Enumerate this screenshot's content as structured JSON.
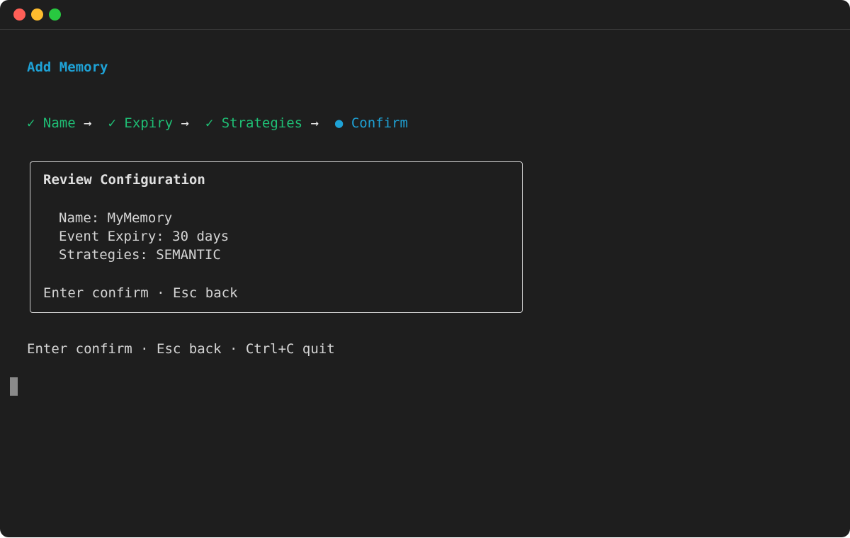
{
  "window": {
    "traffic_lights": [
      "close",
      "minimize",
      "zoom"
    ]
  },
  "screen": {
    "title": "Add Memory",
    "steps": [
      {
        "marker": "✓",
        "label": "Name",
        "status": "done"
      },
      {
        "marker": "✓",
        "label": "Expiry",
        "status": "done"
      },
      {
        "marker": "✓",
        "label": "Strategies",
        "status": "done"
      },
      {
        "marker": "●",
        "label": "Confirm",
        "status": "current"
      }
    ],
    "step_separator": "→",
    "review": {
      "heading": "Review Configuration",
      "fields": [
        {
          "key": "Name",
          "value": "MyMemory"
        },
        {
          "key": "Event Expiry",
          "value": "30 days"
        },
        {
          "key": "Strategies",
          "value": "SEMANTIC"
        }
      ],
      "hint": "Enter confirm · Esc back"
    },
    "footer_hint": "Enter confirm · Esc back · Ctrl+C quit"
  },
  "colors": {
    "background": "#1e1e1e",
    "accent": "#1ea2d6",
    "done": "#1fbf75",
    "text": "#d4d4d4"
  }
}
